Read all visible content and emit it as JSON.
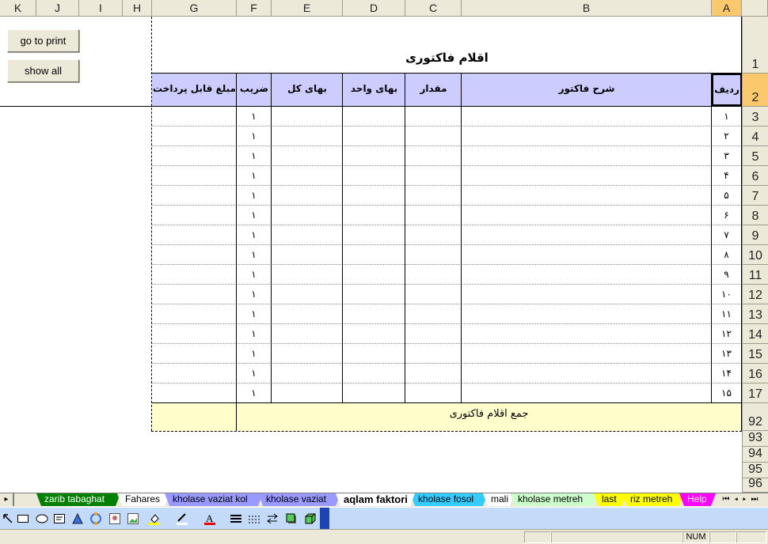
{
  "columns": [
    "K",
    "J",
    "I",
    "H",
    "G",
    "F",
    "E",
    "D",
    "C",
    "B",
    "A"
  ],
  "selected_column": "A",
  "rows": [
    "1",
    "2",
    "3",
    "4",
    "5",
    "6",
    "7",
    "8",
    "9",
    "10",
    "11",
    "12",
    "13",
    "14",
    "15",
    "16",
    "17",
    "92",
    "93",
    "94",
    "95",
    "96"
  ],
  "selected_row": "2",
  "buttons": {
    "go_to_print": "go to print",
    "show_all": "show all"
  },
  "sheet": {
    "title": "اقلام فاکتوری",
    "headers": {
      "radif": "ردیف",
      "sharh": "شرح فاکتور",
      "meghdar": "مقدار",
      "baha_vahed": "بهای واحد",
      "baha_kol": "بهای کل",
      "zarib": "ضریب",
      "mablagh": "مبلغ قابل پرداخت"
    },
    "row_numbers": [
      "۱",
      "۲",
      "۳",
      "۴",
      "۵",
      "۶",
      "۷",
      "۸",
      "۹",
      "۱۰",
      "۱۱",
      "۱۲",
      "۱۳",
      "۱۴",
      "۱۵"
    ],
    "zarib_values": [
      "۱",
      "۱",
      "۱",
      "۱",
      "۱",
      "۱",
      "۱",
      "۱",
      "۱",
      "۱",
      "۱",
      "۱",
      "۱",
      "۱",
      "۱"
    ],
    "total_label": "جمع اقلام فاکتوری"
  },
  "tabs": [
    {
      "label": "zarib tabaghat",
      "color": "#008000",
      "text_color": "#ffffff"
    },
    {
      "label": "Fahares",
      "color": "#ffffff",
      "text_color": "#000000"
    },
    {
      "label": "kholase vaziat kol",
      "color": "#9999ff",
      "text_color": "#000000"
    },
    {
      "label": "kholase vaziat",
      "color": "#9999ff",
      "text_color": "#000000"
    },
    {
      "label": "aqlam faktori",
      "color": "#ffffff",
      "text_color": "#000000"
    },
    {
      "label": "kholase fosol",
      "color": "#33ccff",
      "text_color": "#000000"
    },
    {
      "label": "mali",
      "color": "#ffffff",
      "text_color": "#000000"
    },
    {
      "label": "kholase metreh",
      "color": "#ccffcc",
      "text_color": "#000000"
    },
    {
      "label": "last",
      "color": "#ffff00",
      "text_color": "#000000"
    },
    {
      "label": "riz metreh",
      "color": "#ffff00",
      "text_color": "#000000"
    },
    {
      "label": "Help",
      "color": "#ff00ff",
      "text_color": "#ffffff"
    }
  ],
  "active_tab": "aqlam faktori",
  "drawing_icons": [
    "select-arrow",
    "rectangle",
    "oval",
    "text-box",
    "wordart",
    "diagram",
    "clip-art",
    "picture",
    "fill-color",
    "line-color",
    "font-color",
    "line-style",
    "dash-style",
    "arrow-style",
    "shadow",
    "3d"
  ],
  "status": {
    "num": "NUM"
  }
}
